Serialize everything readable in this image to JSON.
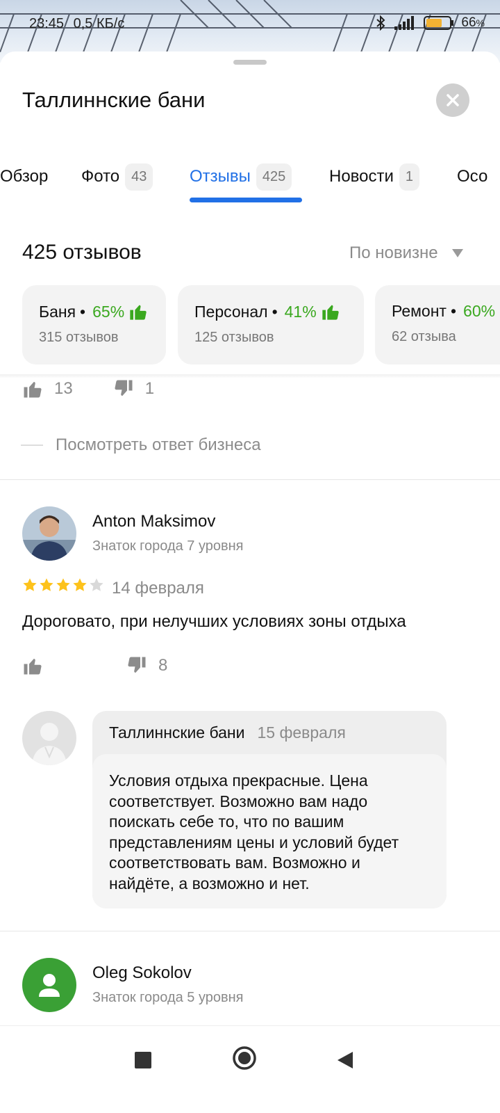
{
  "status": {
    "time": "23:45",
    "speed": "0,5 КБ/с",
    "battery": "66"
  },
  "header": {
    "title": "Таллиннские бани",
    "close_icon": "close-icon"
  },
  "tabs": [
    {
      "label": "Обзор",
      "count": ""
    },
    {
      "label": "Фото",
      "count": "43"
    },
    {
      "label": "Отзывы",
      "count": "425"
    },
    {
      "label": "Новости",
      "count": "1"
    },
    {
      "label": "Осо",
      "count": ""
    }
  ],
  "reviews": {
    "total_label": "425 отзывов",
    "sort_label": "По новизне"
  },
  "topics": [
    {
      "name": "Баня",
      "percent": "65%",
      "sub": "315 отзывов"
    },
    {
      "name": "Персонал",
      "percent": "41%",
      "sub": "125 отзывов"
    },
    {
      "name": "Ремонт",
      "percent": "60%",
      "sub": "62 отзыва"
    }
  ],
  "prev_review": {
    "likes": "13",
    "dislikes": "1",
    "business_link": "Посмотреть ответ бизнеса"
  },
  "review1": {
    "author": "Anton Maksimov",
    "level": "Знаток города 7 уровня",
    "rating": 4,
    "date": "14 февраля",
    "text": "Дороговато, при нелучших условиях зоны отдыха",
    "likes": "",
    "dislikes": "8",
    "reply": {
      "name": "Таллиннские бани",
      "date": "15 февраля",
      "text": "Условия отдыха прекрасные. Цена соответствует. Возможно вам надо поискать себе то, что по вашим представлениям цены и условий будет соответствовать вам. Возможно и найдёте, а возможно и нет."
    }
  },
  "review2": {
    "author": "Oleg Sokolov",
    "level": "Знаток города 5 уровня"
  },
  "colors": {
    "accent": "#2170e6",
    "positive": "#3aa81f",
    "star": "#fdc21b",
    "avatar_green": "#3aa035"
  }
}
